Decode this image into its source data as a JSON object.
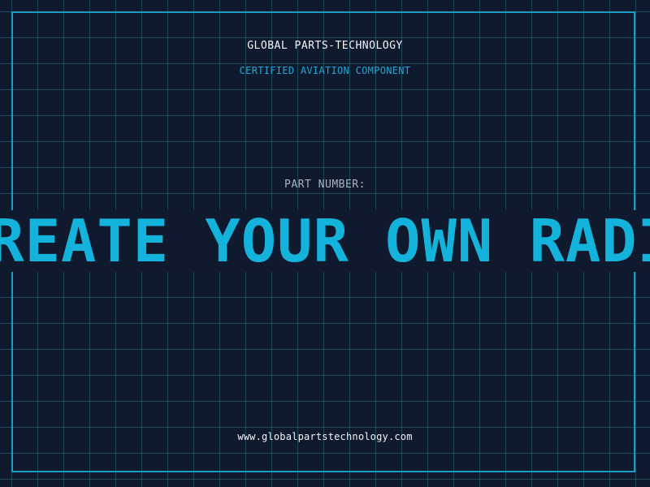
{
  "header": {
    "company": "GLOBAL PARTS-TECHNOLOGY",
    "subtitle": "CERTIFIED AVIATION COMPONENT"
  },
  "part": {
    "label": "PART NUMBER:",
    "value": "CREATE YOUR OWN RADIO"
  },
  "footer": {
    "website": "www.globalpartstechnology.com"
  },
  "colors": {
    "background": "#101a2e",
    "grid": "#286e82",
    "frame": "#1a9cc4",
    "accent": "#14b3dc",
    "subtitle": "#22a6d2",
    "label": "#a8b3c2",
    "text": "#f2f4f7"
  }
}
